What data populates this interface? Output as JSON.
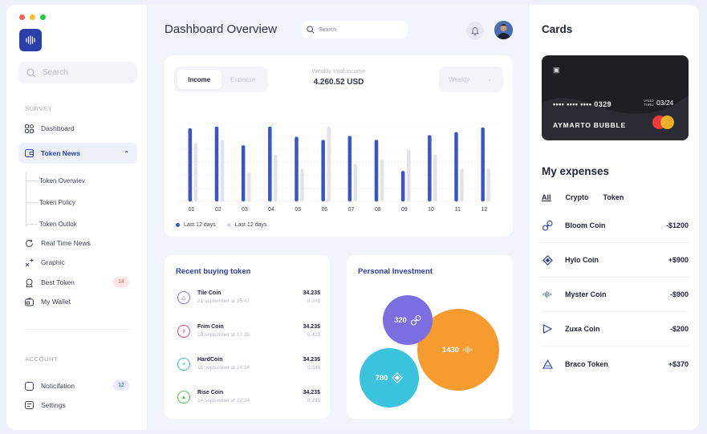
{
  "colors": {
    "primary": "#2b3fa8",
    "bar_primary": "#3a55c8",
    "bar_secondary": "#e2e3ea",
    "orange": "#f59b2f",
    "purple": "#7b6ee0",
    "teal": "#3bc3dd",
    "badge_red_bg": "#fde5e5",
    "badge_red_fg": "#e46666",
    "badge_blue_bg": "#e7ebfb",
    "badge_blue_fg": "#3a55c8"
  },
  "sidebar": {
    "search_placeholder": "Search",
    "survey_label": "SURVEY",
    "items": [
      {
        "label": "Dashboard",
        "icon": "grid-icon"
      },
      {
        "label": "Token News",
        "icon": "wallet-card-icon",
        "active": true
      },
      {
        "label": "Real Time News",
        "icon": "refresh-icon"
      },
      {
        "label": "Graphic",
        "icon": "sparkle-chart-icon"
      },
      {
        "label": "Best Token",
        "icon": "medal-icon",
        "badge": "14"
      },
      {
        "label": "My Wallet",
        "icon": "wallet-icon"
      }
    ],
    "sub_items": [
      "Token Overwiev",
      "Token Policy",
      "Token Outlok"
    ],
    "account_label": "ACCOUNT",
    "account_items": [
      {
        "label": "Noticifation",
        "icon": "bell-square-icon",
        "badge": "12"
      },
      {
        "label": "Settings",
        "icon": "settings-icon"
      }
    ]
  },
  "header": {
    "title": "Dashboard Overview",
    "search_placeholder": "Search"
  },
  "income_card": {
    "tabs": [
      "Income",
      "Expense"
    ],
    "weekly_label": "Weekly total income",
    "weekly_value": "4.260.52 USD",
    "period": "Weekly",
    "legend": [
      "Last 12 days",
      "Last 12 days"
    ]
  },
  "chart_data": {
    "type": "bar",
    "categories": [
      "01",
      "02",
      "03",
      "04",
      "05",
      "06",
      "07",
      "08",
      "09",
      "10",
      "11",
      "12"
    ],
    "series": [
      {
        "name": "Last 12 days",
        "values": [
          94,
          96,
          72,
          96,
          83,
          79,
          84,
          79,
          39,
          85,
          89,
          95
        ]
      },
      {
        "name": "Last 12 days",
        "values": [
          75,
          79,
          37,
          60,
          42,
          96,
          48,
          54,
          66,
          60,
          42,
          42
        ]
      }
    ],
    "ylim": [
      0,
      100
    ],
    "grid": true
  },
  "recent": {
    "title": "Recent buying token",
    "items": [
      {
        "name": "Tile Coin",
        "date": "21 september at 15:47",
        "amount": "34.23$",
        "sub": "0.24$",
        "color": "#8a6fe0",
        "icon": "tile-coin-icon"
      },
      {
        "name": "Frim Coin",
        "date": "19 september at 17:35",
        "amount": "34.23$",
        "sub": "0.42$",
        "color": "#e0467a",
        "icon": "frim-coin-icon"
      },
      {
        "name": "HardCoin",
        "date": "16 september at 14:14",
        "amount": "34.23$",
        "sub": "0.18$",
        "color": "#2fbfa7",
        "icon": "hardcoin-icon"
      },
      {
        "name": "Rise Coin",
        "date": "14 september at 22:34",
        "amount": "34.23$",
        "sub": "0.29$",
        "color": "#4bbf55",
        "icon": "rise-coin-icon"
      }
    ]
  },
  "investment": {
    "title": "Personal Investment",
    "bubbles": [
      {
        "value": "320",
        "icon": "bloom-coin-icon"
      },
      {
        "value": "1430",
        "icon": "myster-coin-icon"
      },
      {
        "value": "780",
        "icon": "hylo-coin-icon"
      }
    ]
  },
  "cards": {
    "title": "Cards",
    "number": "•••• •••• •••• 0329",
    "valid_label_1": "VALID",
    "valid_label_2": "THRU",
    "expiry": "03/24",
    "holder": "AYMARTO BUBBLE"
  },
  "expenses": {
    "title": "My expenses",
    "tabs": [
      "All",
      "Crypto",
      "Token"
    ],
    "items": [
      {
        "name": "Bloom Coin",
        "amount": "-$1200",
        "icon": "bloom-coin-icon"
      },
      {
        "name": "Hylo Coin",
        "amount": "+$900",
        "icon": "hylo-coin-icon"
      },
      {
        "name": "Myster Coin",
        "amount": "-$900",
        "icon": "myster-coin-icon"
      },
      {
        "name": "Zuxa Coin",
        "amount": "-$200",
        "icon": "zuxa-coin-icon"
      },
      {
        "name": "Braco Token",
        "amount": "+$370",
        "icon": "braco-token-icon"
      }
    ]
  }
}
